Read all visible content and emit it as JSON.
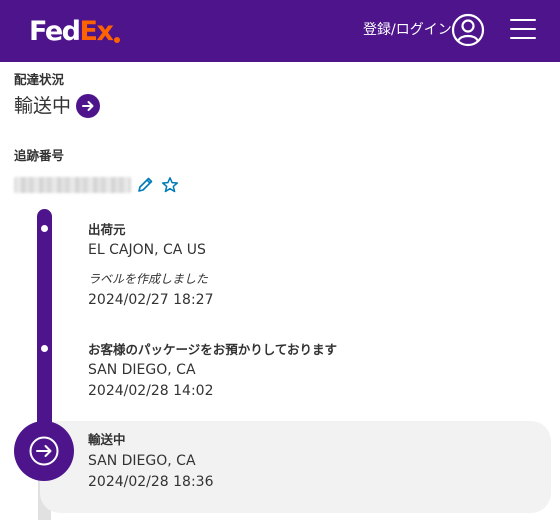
{
  "header": {
    "logo_fed": "Fed",
    "logo_ex": "Ex",
    "login_label": "登録/ログイン",
    "brand_color": "#4d148c",
    "accent_color": "#ff6200"
  },
  "status": {
    "label": "配達状況",
    "value": "輸送中"
  },
  "tracking": {
    "label": "追跡番号"
  },
  "events": [
    {
      "title": "出荷元",
      "location": "EL CAJON, CA US",
      "description": "ラベルを作成しました",
      "datetime": "2024/02/27 18:27"
    },
    {
      "title": "お客様のパッケージをお預かりしております",
      "location": "SAN DIEGO, CA",
      "datetime": "2024/02/28 14:02"
    },
    {
      "title": "輸送中",
      "location": "SAN DIEGO, CA",
      "datetime": "2024/02/28 18:36",
      "current": true
    }
  ]
}
